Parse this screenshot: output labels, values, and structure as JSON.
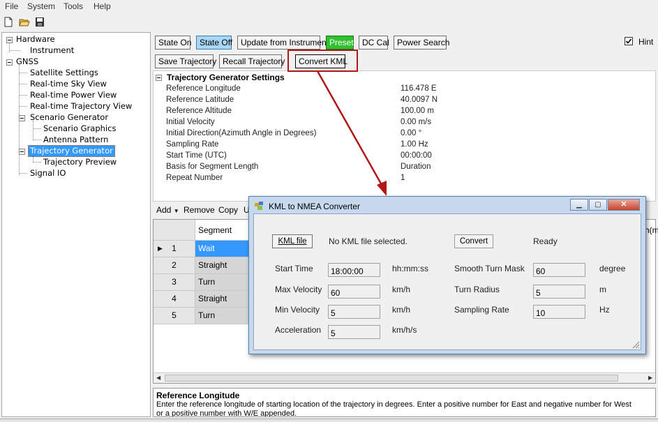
{
  "menu": [
    "File",
    "System",
    "Tools",
    "Help"
  ],
  "toolbar_icons": [
    "new-file-icon",
    "open-folder-icon",
    "save-disk-icon"
  ],
  "tree": {
    "items": [
      {
        "label": "Hardware",
        "name": "tree-hardware"
      },
      {
        "label": "Instrument",
        "name": "tree-instrument"
      },
      {
        "label": "GNSS",
        "name": "tree-gnss"
      },
      {
        "label": "Satellite Settings",
        "name": "tree-satellite-settings"
      },
      {
        "label": "Real-time Sky View",
        "name": "tree-sky-view"
      },
      {
        "label": "Real-time Power View",
        "name": "tree-power-view"
      },
      {
        "label": "Real-time Trajectory View",
        "name": "tree-trajectory-view"
      },
      {
        "label": "Scenario Generator",
        "name": "tree-scenario-generator"
      },
      {
        "label": "Scenario Graphics",
        "name": "tree-scenario-graphics"
      },
      {
        "label": "Antenna Pattern",
        "name": "tree-antenna-pattern"
      },
      {
        "label": "Trajectory Generator",
        "name": "tree-trajectory-generator"
      },
      {
        "label": "Trajectory Preview",
        "name": "tree-trajectory-preview"
      },
      {
        "label": "Signal IO",
        "name": "tree-signal-io"
      }
    ]
  },
  "buttons_row1": {
    "state_on": "State On",
    "state_off": "State Off",
    "update": "Update from Instrument",
    "preset": "Preset",
    "dc_cal": "DC Cal",
    "power_search": "Power Search"
  },
  "hint": {
    "label": "Hint",
    "checked": true
  },
  "buttons_row2": {
    "save": "Save Trajectory",
    "recall": "Recall Trajectory",
    "convert": "Convert KML"
  },
  "settings": {
    "title": "Trajectory Generator Settings",
    "rows": [
      {
        "label": "Reference Longitude",
        "value": "116.478 E"
      },
      {
        "label": "Reference Latitude",
        "value": "40.0097 N"
      },
      {
        "label": "Reference Altitude",
        "value": "100.00 m"
      },
      {
        "label": "Initial Velocity",
        "value": "0.00 m/s"
      },
      {
        "label": "Initial Direction(Azimuth Angle in Degrees)",
        "value": "0.00 °"
      },
      {
        "label": "Sampling Rate",
        "value": "1.00 Hz"
      },
      {
        "label": "Start Time (UTC)",
        "value": "00:00:00"
      },
      {
        "label": "Basis for Segment Length",
        "value": "Duration"
      },
      {
        "label": "Repeat Number",
        "value": "1"
      }
    ]
  },
  "segment_toolbar": {
    "add": "Add",
    "remove": "Remove",
    "copy": "Copy",
    "u": "U"
  },
  "grid": {
    "header": "Segment",
    "right_clip": "h(m",
    "rows": [
      {
        "num": "1",
        "segment": "Wait"
      },
      {
        "num": "2",
        "segment": "Straight"
      },
      {
        "num": "3",
        "segment": "Turn"
      },
      {
        "num": "4",
        "segment": "Straight"
      },
      {
        "num": "5",
        "segment": "Turn"
      }
    ]
  },
  "description": {
    "title": "Reference Longitude",
    "text": "Enter the reference longitude of starting location of the trajectory in degrees. Enter a positive number for East and negative number for West or a positive number with W/E appended."
  },
  "dialog": {
    "title": "KML to NMEA Converter",
    "kml_button": "KML file",
    "kml_status": "No KML file selected.",
    "convert_button": "Convert",
    "status": "Ready",
    "fields": {
      "start_time": {
        "label": "Start Time",
        "value": "18:00:00",
        "unit": "hh:mm:ss"
      },
      "max_velocity": {
        "label": "Max Velocity",
        "value": "60",
        "unit": "km/h"
      },
      "min_velocity": {
        "label": "Min Velocity",
        "value": "5",
        "unit": "km/h"
      },
      "acceleration": {
        "label": "Acceleration",
        "value": "5",
        "unit": "km/h/s"
      },
      "smooth_turn_mask": {
        "label": "Smooth Turn Mask",
        "value": "60",
        "unit": "degree"
      },
      "turn_radius": {
        "label": "Turn Radius",
        "value": "5",
        "unit": "m"
      },
      "sampling_rate": {
        "label": "Sampling Rate",
        "value": "10",
        "unit": "Hz"
      }
    }
  },
  "colors": {
    "accent": "#3399ff",
    "preset": "#2fc22f",
    "annotation": "#b01818"
  }
}
